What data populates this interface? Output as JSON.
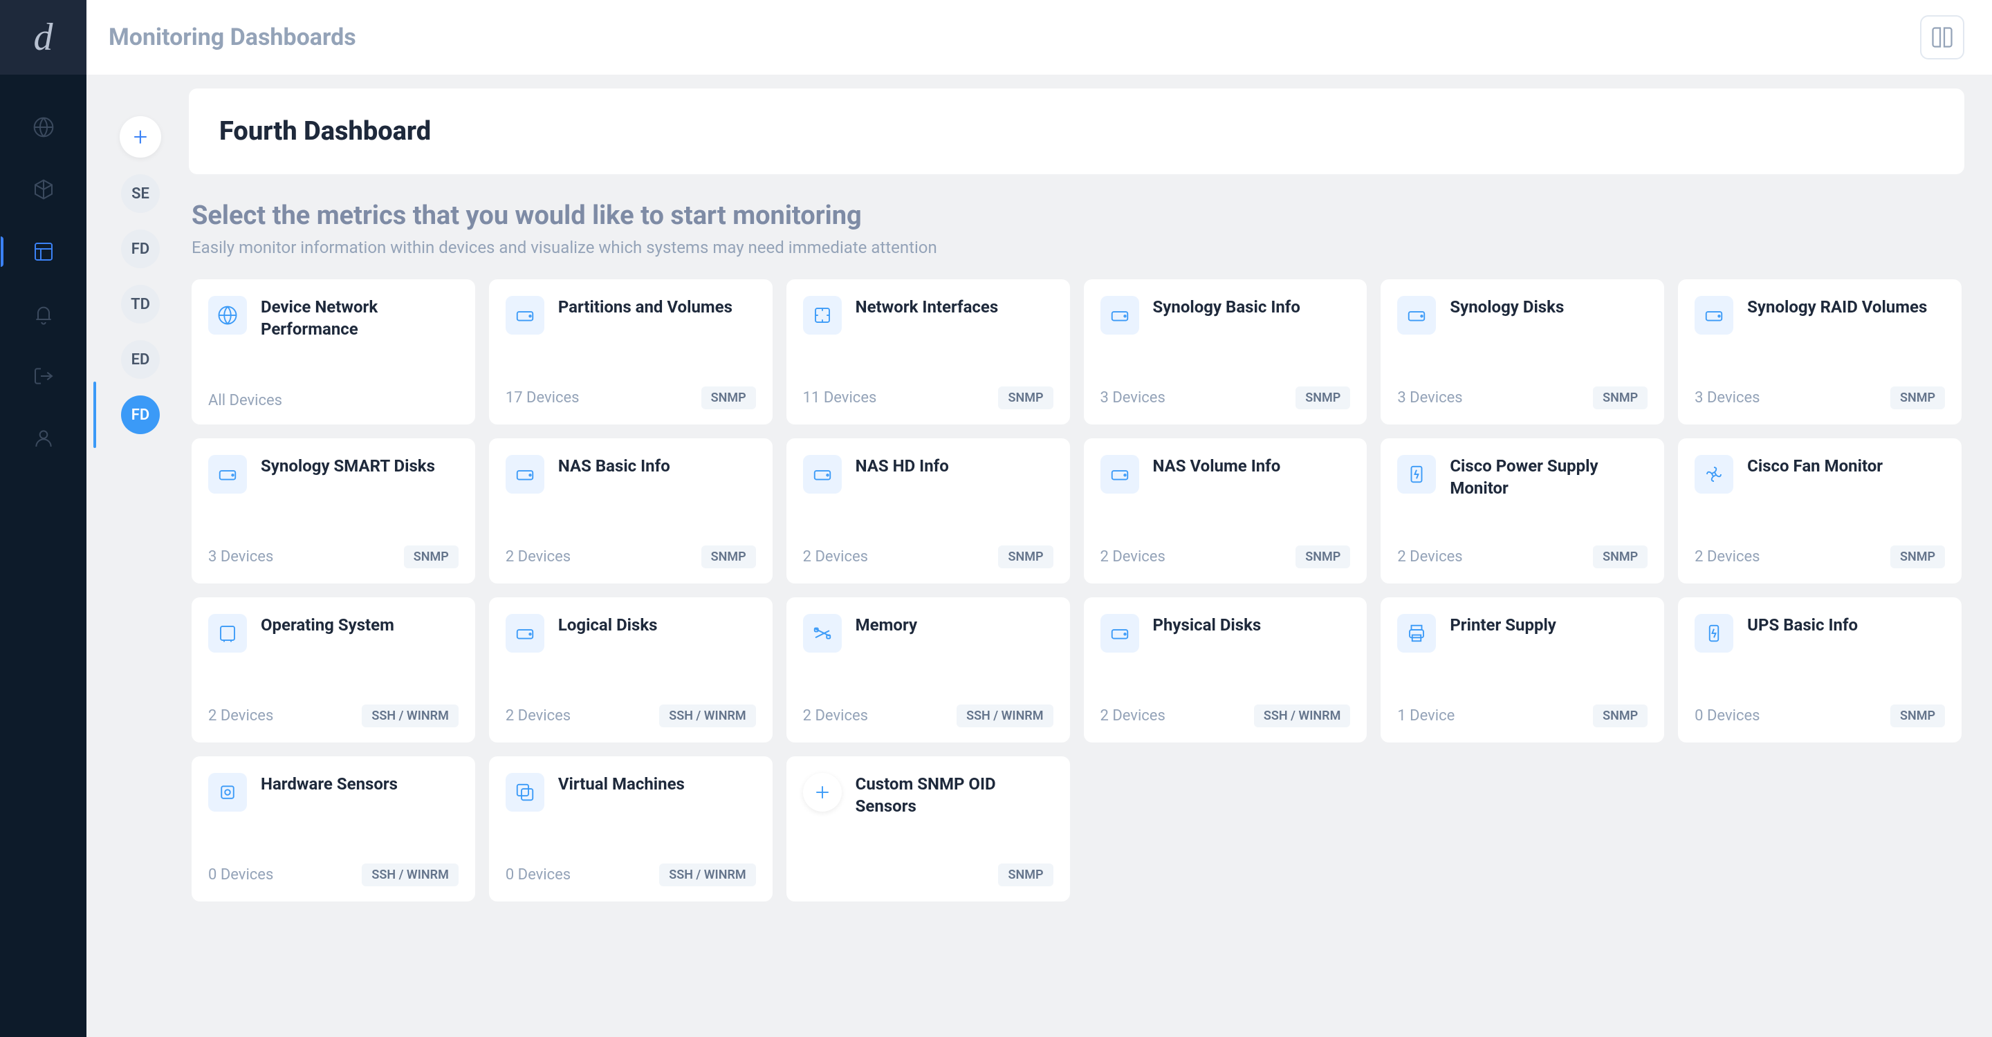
{
  "header": {
    "page_title": "Monitoring Dashboards"
  },
  "dashboards": {
    "add_label": "+",
    "items": [
      {
        "code": "SE"
      },
      {
        "code": "FD"
      },
      {
        "code": "TD"
      },
      {
        "code": "ED"
      },
      {
        "code": "FD"
      }
    ]
  },
  "panel": {
    "title": "Fourth Dashboard",
    "intro_title": "Select the metrics that you would like to start monitoring",
    "intro_sub": "Easily monitor information within devices and visualize which systems may need immediate attention"
  },
  "metrics": [
    {
      "title": "Device Network Performance",
      "devices": "All Devices",
      "tag": "",
      "icon": "globe"
    },
    {
      "title": "Partitions and Volumes",
      "devices": "17 Devices",
      "tag": "SNMP",
      "icon": "disk"
    },
    {
      "title": "Network Interfaces",
      "devices": "11 Devices",
      "tag": "SNMP",
      "icon": "network"
    },
    {
      "title": "Synology Basic Info",
      "devices": "3 Devices",
      "tag": "SNMP",
      "icon": "disk"
    },
    {
      "title": "Synology Disks",
      "devices": "3 Devices",
      "tag": "SNMP",
      "icon": "disk"
    },
    {
      "title": "Synology RAID Volumes",
      "devices": "3 Devices",
      "tag": "SNMP",
      "icon": "disk"
    },
    {
      "title": "Synology SMART Disks",
      "devices": "3 Devices",
      "tag": "SNMP",
      "icon": "disk"
    },
    {
      "title": "NAS Basic Info",
      "devices": "2 Devices",
      "tag": "SNMP",
      "icon": "disk"
    },
    {
      "title": "NAS HD Info",
      "devices": "2 Devices",
      "tag": "SNMP",
      "icon": "disk"
    },
    {
      "title": "NAS Volume Info",
      "devices": "2 Devices",
      "tag": "SNMP",
      "icon": "disk"
    },
    {
      "title": "Cisco Power Supply Monitor",
      "devices": "2 Devices",
      "tag": "SNMP",
      "icon": "power"
    },
    {
      "title": "Cisco Fan Monitor",
      "devices": "2 Devices",
      "tag": "SNMP",
      "icon": "fan"
    },
    {
      "title": "Operating System",
      "devices": "2 Devices",
      "tag": "SSH / WINRM",
      "icon": "os"
    },
    {
      "title": "Logical Disks",
      "devices": "2 Devices",
      "tag": "SSH / WINRM",
      "icon": "disk"
    },
    {
      "title": "Memory",
      "devices": "2 Devices",
      "tag": "SSH / WINRM",
      "icon": "memory"
    },
    {
      "title": "Physical Disks",
      "devices": "2 Devices",
      "tag": "SSH / WINRM",
      "icon": "disk"
    },
    {
      "title": "Printer Supply",
      "devices": "1 Device",
      "tag": "SNMP",
      "icon": "printer"
    },
    {
      "title": "UPS Basic Info",
      "devices": "0 Devices",
      "tag": "SNMP",
      "icon": "ups"
    },
    {
      "title": "Hardware Sensors",
      "devices": "0 Devices",
      "tag": "SSH / WINRM",
      "icon": "sensor"
    },
    {
      "title": "Virtual Machines",
      "devices": "0 Devices",
      "tag": "SSH / WINRM",
      "icon": "vm"
    },
    {
      "title": "Custom SNMP OID Sensors",
      "devices": "",
      "tag": "SNMP",
      "icon": "plus"
    }
  ]
}
